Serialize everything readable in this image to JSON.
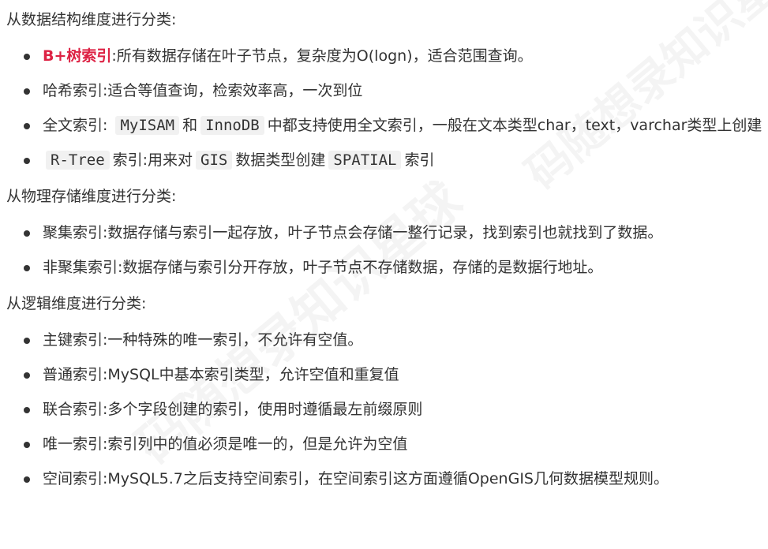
{
  "section1": {
    "heading": "从数据结构维度进行分类:",
    "items": [
      {
        "label": "B+树索引",
        "text": ":所有数据存储在叶子节点，复杂度为O(logn)，适合范围查询。"
      },
      {
        "text": "哈希索引:适合等值查询，检索效率高，一次到位"
      },
      {
        "prefix": "全文索引: ",
        "code1": "MyISAM",
        "mid": "和",
        "code2": "InnoDB",
        "suffix": "中都支持使用全文索引，一般在文本类型char，text，varchar类型上创建"
      },
      {
        "code1": "R-Tree",
        "mid1": "索引:用来对",
        "code2": "GIS",
        "mid2": "数据类型创建",
        "code3": "SPATIAL",
        "suffix": "索引"
      }
    ]
  },
  "section2": {
    "heading": "从物理存储维度进行分类:",
    "items": [
      {
        "text": "聚集索引:数据存储与索引一起存放，叶子节点会存储一整行记录，找到索引也就找到了数据。"
      },
      {
        "text": "非聚集索引:数据存储与索引分开存放，叶子节点不存储数据，存储的是数据行地址。"
      }
    ]
  },
  "section3": {
    "heading": "从逻辑维度进行分类:",
    "items": [
      {
        "text": "主键索引:一种特殊的唯一索引，不允许有空值。"
      },
      {
        "text": "普通索引:MySQL中基本索引类型，允许空值和重复值"
      },
      {
        "text": "联合索引:多个字段创建的索引，使用时遵循最左前缀原则"
      },
      {
        "text": "唯一索引:索引列中的值必须是唯一的，但是允许为空值"
      },
      {
        "text": "空间索引:MySQL5.7之后支持空间索引，在空间索引这方面遵循OpenGIS几何数据模型规则。"
      }
    ]
  },
  "watermark": "码随想录知识星球",
  "colors": {
    "accent": "#dd2244",
    "text": "#333333",
    "code_bg": "#f1f1f1"
  }
}
